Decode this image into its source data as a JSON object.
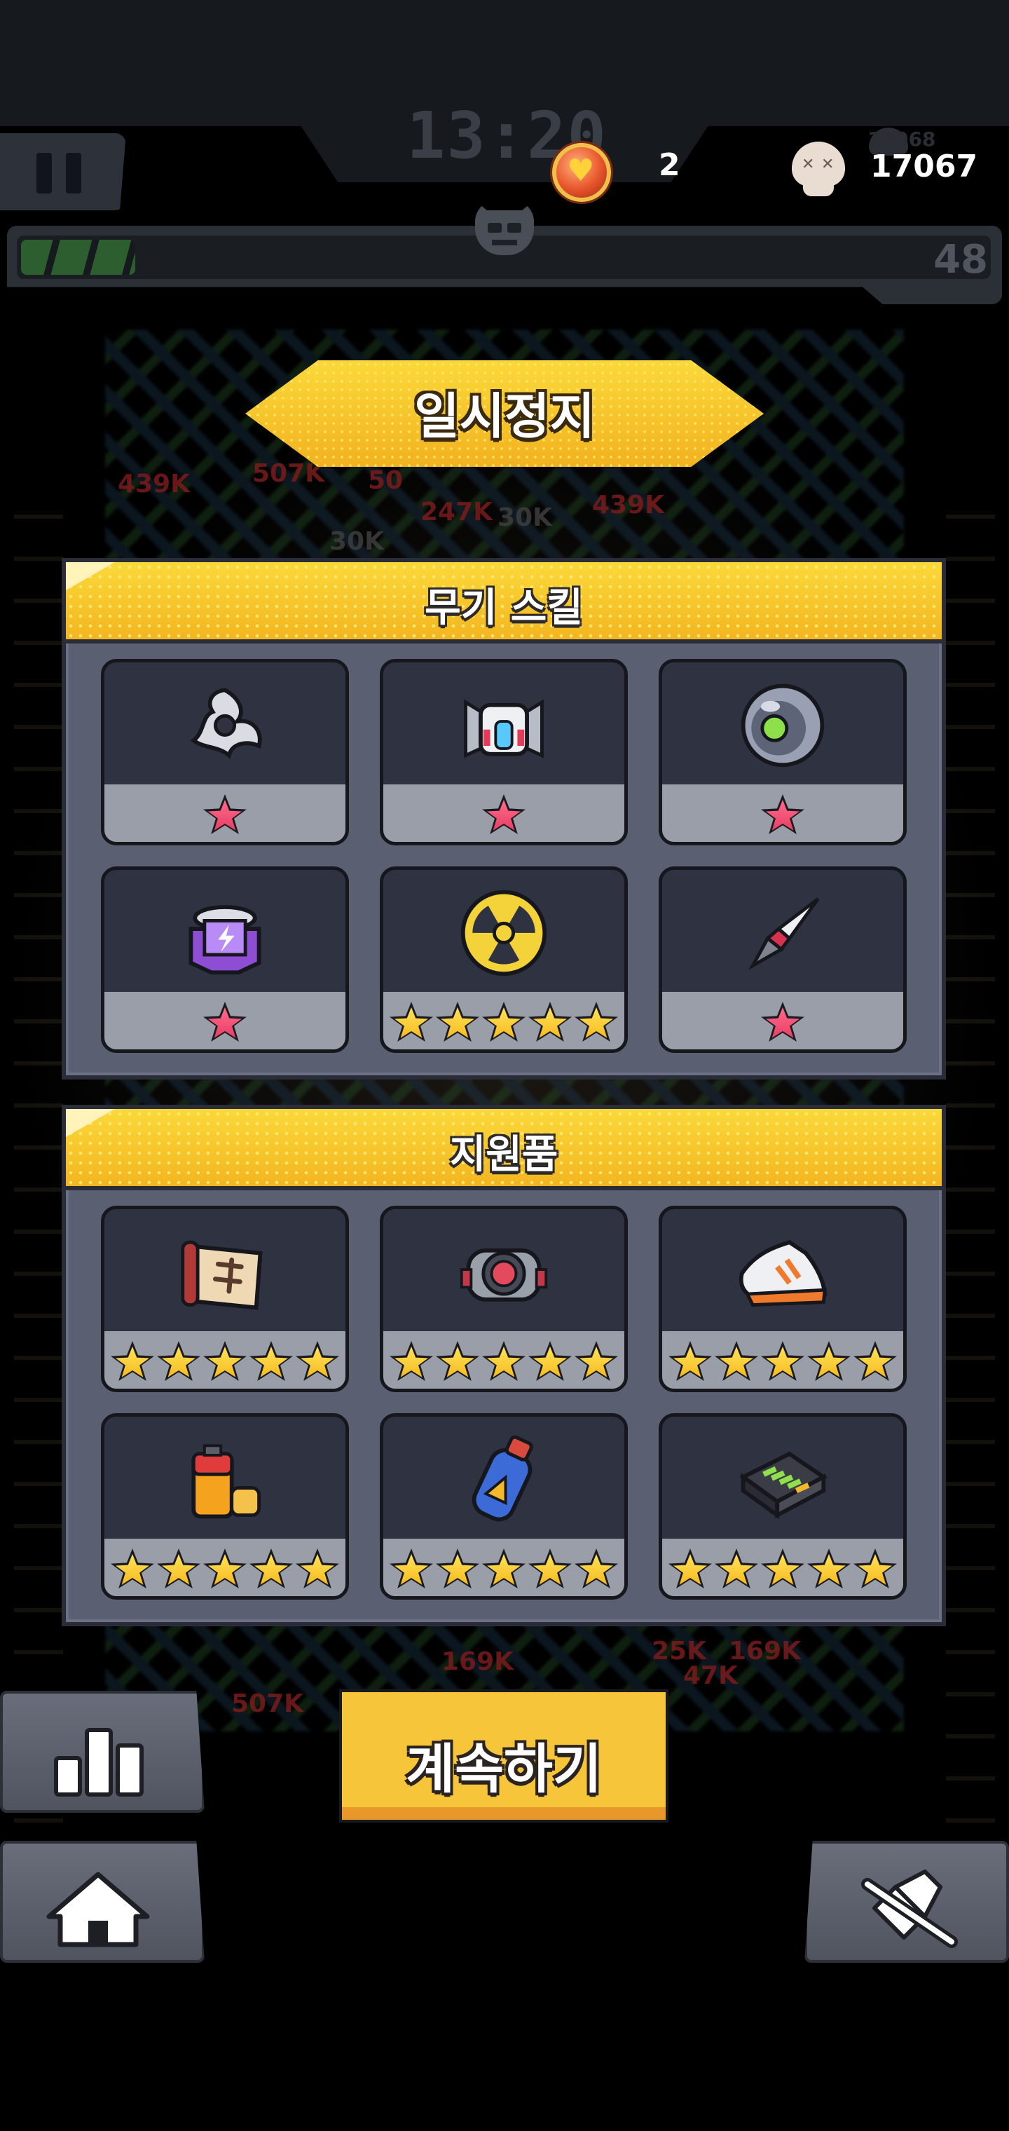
{
  "hud": {
    "timer": "13:20",
    "coins": "2",
    "kills": "17067",
    "kills_shadow": "17068",
    "level": "48",
    "xp_progress": 0.06
  },
  "pause_screen": {
    "title": "일시정지"
  },
  "weapon_skills": {
    "title": "무기 스킬",
    "slots": [
      {
        "icon": "shuriken-icon",
        "stars": 1,
        "star_color": "pink"
      },
      {
        "icon": "drone-icon",
        "stars": 1,
        "star_color": "pink"
      },
      {
        "icon": "orb-icon",
        "stars": 1,
        "star_color": "pink"
      },
      {
        "icon": "energy-crystal-icon",
        "stars": 1,
        "star_color": "pink"
      },
      {
        "icon": "radiation-icon",
        "stars": 5,
        "star_color": "gold"
      },
      {
        "icon": "kunai-icon",
        "stars": 1,
        "star_color": "pink"
      }
    ]
  },
  "supplies": {
    "title": "지원품",
    "slots": [
      {
        "icon": "scroll-icon",
        "stars": 5,
        "star_color": "gold"
      },
      {
        "icon": "magnet-core-icon",
        "stars": 5,
        "star_color": "gold"
      },
      {
        "icon": "sneaker-icon",
        "stars": 5,
        "star_color": "gold"
      },
      {
        "icon": "battery-icon",
        "stars": 5,
        "star_color": "gold"
      },
      {
        "icon": "fuel-canister-icon",
        "stars": 5,
        "star_color": "gold"
      },
      {
        "icon": "power-pack-icon",
        "stars": 5,
        "star_color": "gold"
      }
    ]
  },
  "buttons": {
    "continue_label": "계속하기",
    "stats": "bar-chart-icon",
    "home": "home-icon",
    "sound": "sound-off-icon"
  },
  "background_damage": [
    "439K",
    "507K",
    "50",
    "247K",
    "30K",
    "439K",
    "30K",
    "169K",
    "25K",
    "47K",
    "169K",
    "507K"
  ],
  "colors": {
    "accent_yellow": "#f6c53a",
    "panel": "#5b5f72",
    "slot_dark": "#2f3341",
    "slot_light": "#9a9ea9",
    "star_pink": "#e63c62",
    "star_gold": "#f6b91c"
  }
}
